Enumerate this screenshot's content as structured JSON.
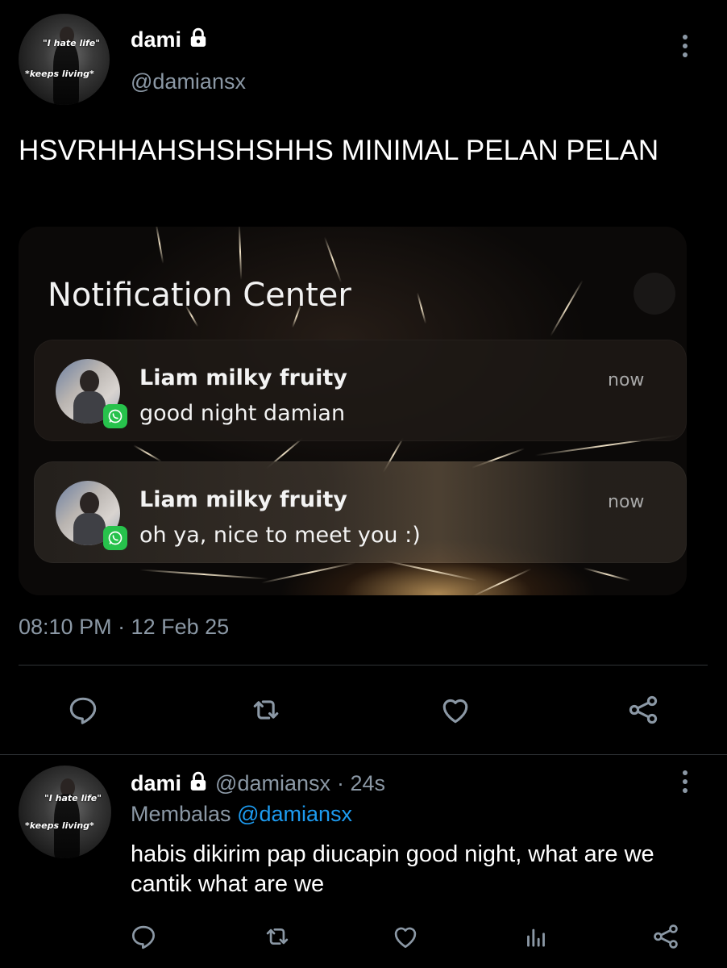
{
  "tweet": {
    "avatar_caption_top": "\"I hate life\"",
    "avatar_caption_bottom": "*keeps living*",
    "display_name": "dami",
    "handle": "@damiansx",
    "text": "HSVRHHAHSHSHSHHS MINIMAL PELAN PELAN",
    "timestamp": "08:10 PM · 12 Feb 25",
    "icons": [
      "lock-icon",
      "more-icon",
      "reply-icon",
      "retweet-icon",
      "like-icon",
      "share-icon"
    ]
  },
  "notification_image": {
    "title": "Notification Center",
    "notifications": [
      {
        "sender": "Liam milky fruity",
        "message": "good night damian",
        "time": "now",
        "app_icon": "whatsapp-icon"
      },
      {
        "sender": "Liam milky fruity",
        "message": "oh ya, nice to meet you :)",
        "time": "now",
        "app_icon": "whatsapp-icon"
      }
    ]
  },
  "reply": {
    "avatar_caption_top": "\"I hate life\"",
    "avatar_caption_bottom": "*keeps living*",
    "display_name": "dami",
    "handle": "@damiansx",
    "age": "· 24s",
    "replying_prefix": "Membalas",
    "replying_to": "@damiansx",
    "text": "habis dikirim pap diucapin good night, what are we cantik what are we",
    "icons": [
      "reply-icon",
      "retweet-icon",
      "like-icon",
      "analytics-icon",
      "share-icon"
    ]
  },
  "colors": {
    "background": "#000000",
    "text": "#e7e9ea",
    "muted": "#8b98a5",
    "link": "#1d9bf0",
    "whatsapp": "#27c24c"
  }
}
